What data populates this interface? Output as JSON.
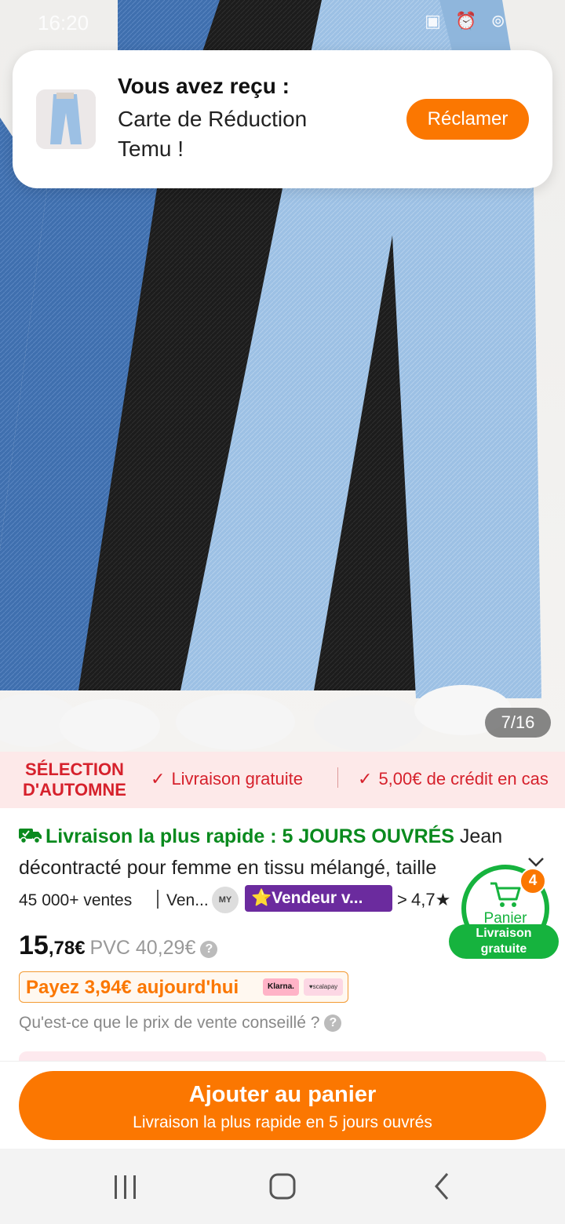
{
  "status_bar": {
    "time": "16:20",
    "icons": "▣ ⏰ ⊚"
  },
  "notification": {
    "title": "Vous avez reçu :",
    "line1": "Carte de Réduction",
    "line2": "Temu !",
    "claim_label": "Réclamer"
  },
  "gallery": {
    "counter": "7/16"
  },
  "autumn_banner": {
    "tag": "SÉLECTION D'AUTOMNE",
    "items": [
      "Livraison gratuite",
      "5,00€ de crédit en cas"
    ],
    "check": "✓",
    "color": "#d6212c"
  },
  "product": {
    "fast_delivery": "Livraison la plus rapide : 5 JOURS OUVRÉS",
    "title": " Jean décontracté pour femme en tissu mélangé, taille",
    "sales": "45 000+ ventes",
    "seller": "Ven...",
    "seller_logo": "MY",
    "seller_badge": "⭐Vendeur v...",
    "seller_chevron": ">",
    "rating": "4,7★",
    "price_int": "15",
    "price_dec": ",78€",
    "rrp": "PVC 40,29€",
    "pay_today": "Payez 3,94€ aujourd'hui",
    "klarna": "Klarna.",
    "scalapay": "♥scalapay",
    "rrp_question": "Qu'est-ce que le prix de vente conseillé ?",
    "help": "?"
  },
  "cart": {
    "label": "Panier",
    "count": "4",
    "free_shipping_line1": "Livraison",
    "free_shipping_line2": "gratuite",
    "color": "#16b33e"
  },
  "cta": {
    "main": "Ajouter au panier",
    "sub": "Livraison la plus rapide en 5 jours ouvrés",
    "color": "#fb7701"
  },
  "system_nav": {
    "recent": "recent-apps-icon",
    "home": "home-icon",
    "back": "back-icon"
  }
}
